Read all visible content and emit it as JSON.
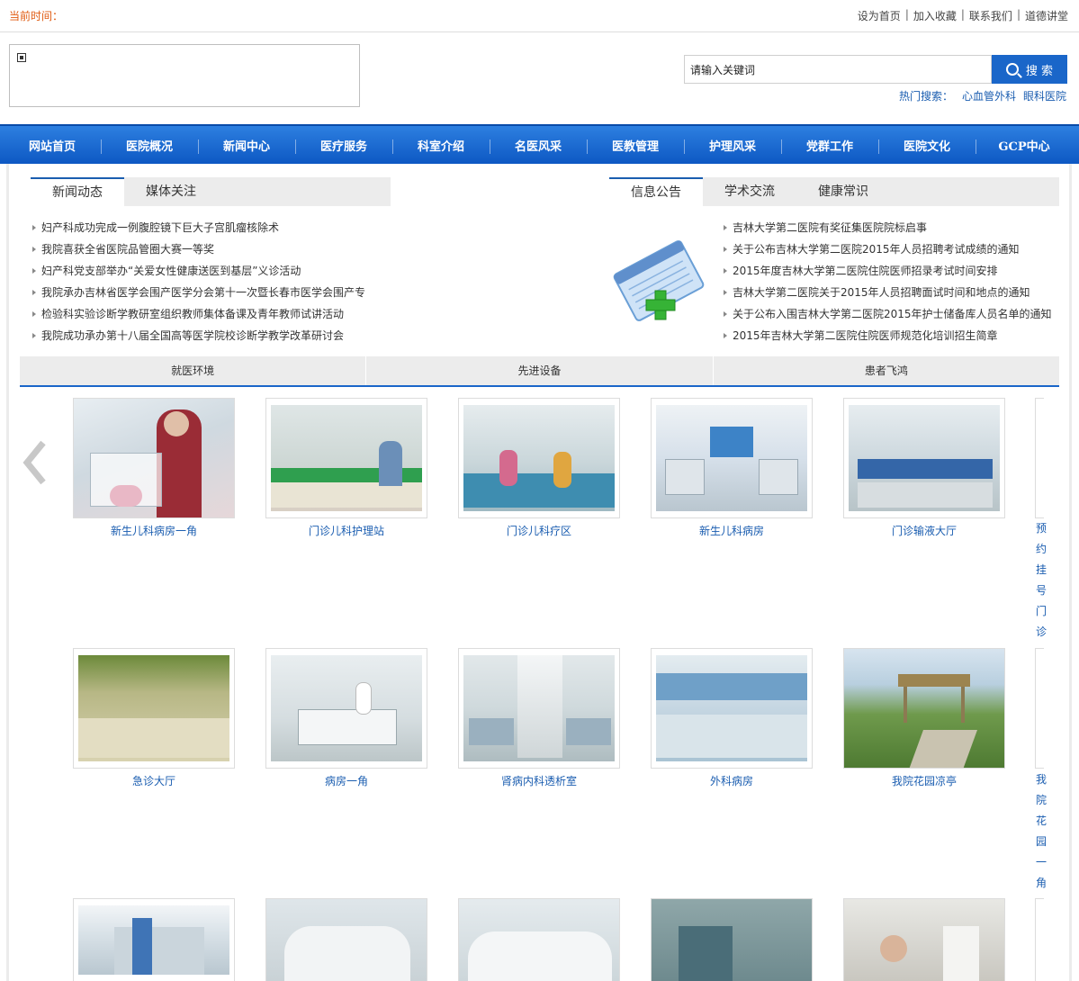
{
  "topbar": {
    "time_label": "当前时间：",
    "links": [
      "设为首页",
      "加入收藏",
      "联系我们",
      "道德讲堂"
    ]
  },
  "search": {
    "value": "请输入关键词",
    "button": "搜 索",
    "hot_label": "热门搜索：",
    "hot_keywords": [
      "心血管外科",
      "眼科医院"
    ]
  },
  "nav": [
    "网站首页",
    "医院概况",
    "新闻中心",
    "医疗服务",
    "科室介绍",
    "名医风采",
    "医教管理",
    "护理风采",
    "党群工作",
    "医院文化",
    "GCP中心"
  ],
  "news": {
    "tabs": [
      "新闻动态",
      "媒体关注"
    ],
    "items": [
      "妇产科成功完成一例腹腔镜下巨大子宫肌瘤核除术",
      "我院喜获全省医院品管圈大赛一等奖",
      "妇产科党支部举办“关爱女性健康送医到基层”义诊活动",
      "我院承办吉林省医学会围产医学分会第十一次暨长春市医学会围产专",
      "检验科实验诊断学教研室组织教师集体备课及青年教师试讲活动",
      "我院成功承办第十八届全国高等医学院校诊断学教学改革研讨会"
    ]
  },
  "notice": {
    "tabs": [
      "信息公告",
      "学术交流",
      "健康常识"
    ],
    "items": [
      "吉林大学第二医院有奖征集医院院标启事",
      "关于公布吉林大学第二医院2015年人员招聘考试成绩的通知",
      "2015年度吉林大学第二医院住院医师招录考试时间安排",
      "吉林大学第二医院关于2015年人员招聘面试时间和地点的通知",
      "关于公布入围吉林大学第二医院2015年护士储备库人员名单的通知",
      "2015年吉林大学第二医院住院医师规范化培训招生简章"
    ]
  },
  "gallery": {
    "tabs": [
      "就医环境",
      "先进设备",
      "患者飞鸿"
    ],
    "row1": [
      "新生儿科病房一角",
      "门诊儿科护理站",
      "门诊儿科疗区",
      "新生儿科病房",
      "门诊输液大厅"
    ],
    "row2": [
      "急诊大厅",
      "病房一角",
      "肾病内科透析室",
      "外科病房",
      "我院花园凉亭"
    ],
    "edge_text_1": [
      "预",
      "约",
      "挂",
      "号",
      "门",
      "诊"
    ],
    "edge_text_2": [
      "我",
      "院",
      "花",
      "园",
      "一",
      "角"
    ]
  },
  "colors": {
    "nav_blue": "#1a66c9",
    "link_blue": "#1a5db0",
    "time_orange": "#e05b12"
  }
}
